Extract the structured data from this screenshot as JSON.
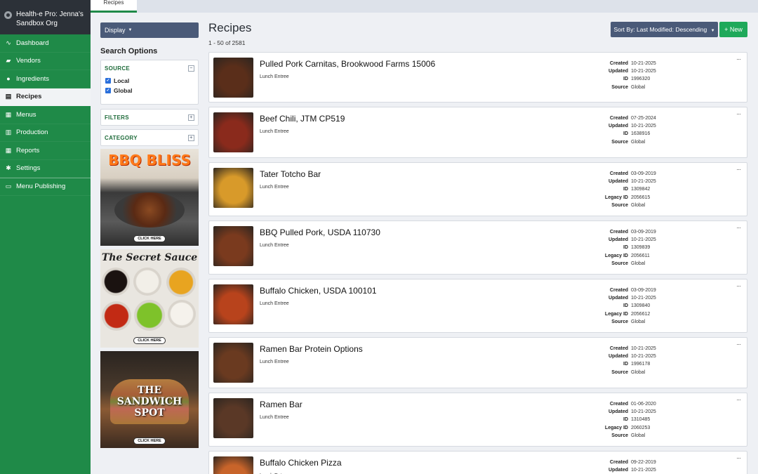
{
  "org": {
    "name": "Health-e Pro: Jenna's Sandbox Org"
  },
  "topbar": {
    "active_tab": "Recipes"
  },
  "sidebar": {
    "items": [
      {
        "label": "Dashboard",
        "icon": "chart-line-icon",
        "active": false
      },
      {
        "label": "Vendors",
        "icon": "truck-icon",
        "active": false
      },
      {
        "label": "Ingredients",
        "icon": "apple-icon",
        "active": false
      },
      {
        "label": "Recipes",
        "icon": "document-icon",
        "active": true
      },
      {
        "label": "Menus",
        "icon": "calendar-icon",
        "active": false
      },
      {
        "label": "Production",
        "icon": "clipboard-icon",
        "active": false
      },
      {
        "label": "Reports",
        "icon": "table-icon",
        "active": false
      },
      {
        "label": "Settings",
        "icon": "gear-icon",
        "active": false
      },
      {
        "label": "Menu Publishing",
        "icon": "monitor-icon",
        "active": false
      }
    ]
  },
  "filters": {
    "display_label": "Display",
    "search_options_title": "Search Options",
    "source": {
      "title": "SOURCE",
      "options": [
        {
          "label": "Local",
          "checked": true
        },
        {
          "label": "Global",
          "checked": true
        }
      ]
    },
    "filters_title": "FILTERS",
    "category_title": "CATEGORY"
  },
  "ads": [
    {
      "title": "BBQ BLISS",
      "cta": "CLICK HERE"
    },
    {
      "title": "The Secret Sauce",
      "cta": "CLICK HERE"
    },
    {
      "title": "THE SANDWICH SPOT",
      "cta": "CLICK HERE"
    }
  ],
  "main": {
    "title": "Recipes",
    "count": "1 - 50 of 2581",
    "sort_label": "Sort By: Last Modified: Descending",
    "new_label": "+ New"
  },
  "labels": {
    "created": "Created",
    "updated": "Updated",
    "id": "ID",
    "legacy_id": "Legacy ID",
    "source": "Source",
    "more": "···"
  },
  "recipes": [
    {
      "name": "Pulled Pork Carnitas, Brookwood Farms 15006",
      "category": "Lunch Entree",
      "created": "10-21-2025",
      "updated": "10-21-2025",
      "id": "1996320",
      "legacy_id": "",
      "source": "Global",
      "thumb_color": "#5a2e1a"
    },
    {
      "name": "Beef Chili, JTM CP519",
      "category": "Lunch Entree",
      "created": "07-25-2024",
      "updated": "10-21-2025",
      "id": "1638916",
      "legacy_id": "",
      "source": "Global",
      "thumb_color": "#8a2a1c"
    },
    {
      "name": "Tater Totcho Bar",
      "category": "Lunch Entree",
      "created": "03-09-2019",
      "updated": "10-21-2025",
      "id": "1309842",
      "legacy_id": "2056615",
      "source": "Global",
      "thumb_color": "#d89a2a"
    },
    {
      "name": "BBQ Pulled Pork, USDA 110730",
      "category": "Lunch Entree",
      "created": "03-09-2019",
      "updated": "10-21-2025",
      "id": "1309839",
      "legacy_id": "2056611",
      "source": "Global",
      "thumb_color": "#7a3a1e"
    },
    {
      "name": "Buffalo Chicken, USDA 100101",
      "category": "Lunch Entree",
      "created": "03-09-2019",
      "updated": "10-21-2025",
      "id": "1309840",
      "legacy_id": "2056612",
      "source": "Global",
      "thumb_color": "#b8431c"
    },
    {
      "name": "Ramen Bar Protein Options",
      "category": "Lunch Entree",
      "created": "10-21-2025",
      "updated": "10-21-2025",
      "id": "1996178",
      "legacy_id": "",
      "source": "Global",
      "thumb_color": "#6a3a20"
    },
    {
      "name": "Ramen Bar",
      "category": "Lunch Entree",
      "created": "01-06-2020",
      "updated": "10-21-2025",
      "id": "1310485",
      "legacy_id": "2060253",
      "source": "Global",
      "thumb_color": "#5a3826"
    },
    {
      "name": "Buffalo Chicken Pizza",
      "category": "Lunch Entree",
      "created": "09-22-2019",
      "updated": "10-21-2025",
      "id": "",
      "legacy_id": "",
      "source": "",
      "thumb_color": "#c8642a"
    }
  ]
}
